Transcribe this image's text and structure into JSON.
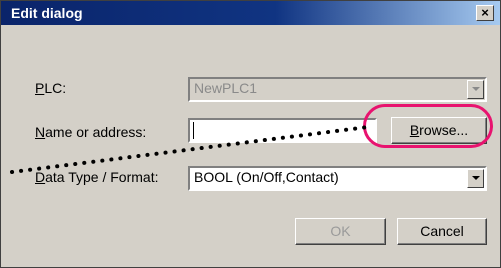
{
  "dialog": {
    "title": "Edit dialog",
    "close_label": "×"
  },
  "plc": {
    "label_prefix": "",
    "label_accel": "P",
    "label_rest": "LC:",
    "value": "NewPLC1"
  },
  "name_address": {
    "label_accel": "N",
    "label_rest": "ame or address:",
    "value": ""
  },
  "browse": {
    "label_accel": "B",
    "label_rest": "rowse..."
  },
  "data_type": {
    "label_accel": "D",
    "label_rest": "ata Type / Format:",
    "value": "BOOL (On/Off,Contact)"
  },
  "buttons": {
    "ok": "OK",
    "cancel": "Cancel"
  },
  "annotation": {
    "color": "#e8136f"
  }
}
